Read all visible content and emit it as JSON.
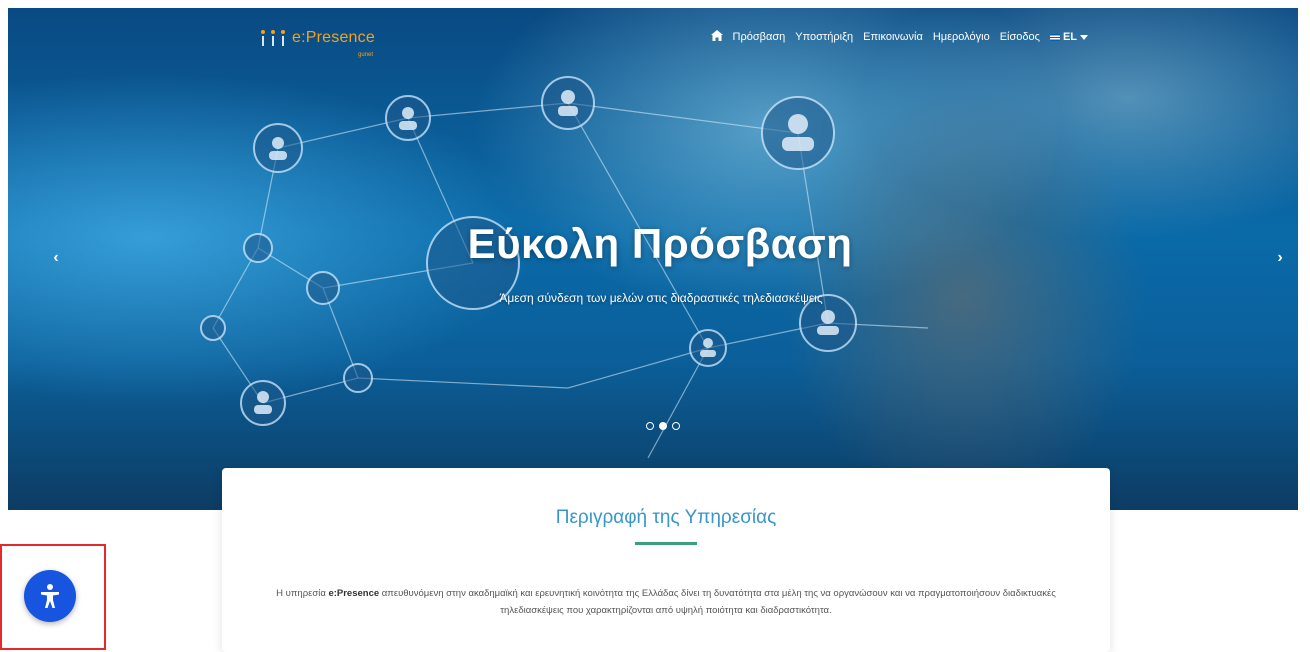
{
  "header": {
    "logo_text": "e:Presence",
    "logo_sub": "gunet",
    "nav": {
      "items": [
        "Πρόσβαση",
        "Υποστήριξη",
        "Επικοινωνία",
        "Ημερολόγιο",
        "Είσοδος"
      ],
      "language": "EL"
    }
  },
  "hero": {
    "title": "Εύκολη Πρόσβαση",
    "subtitle": "Άμεση σύνδεση των μελών στις διαδραστικές τηλεδιασκέψεις",
    "prev_arrow": "‹",
    "next_arrow": "›",
    "slides": 3,
    "active_slide": 2
  },
  "card": {
    "title": "Περιγραφή της Υπηρεσίας",
    "text_before": "Η υπηρεσία ",
    "text_bold": "e:Presence",
    "text_after": " απευθυνόμενη στην ακαδημαϊκή και ερευνητική κοινότητα της Ελλάδας δίνει τη δυνατότητα στα μέλη της να οργανώσουν και να πραγματοποιήσουν διαδικτυακές τηλεδιασκέψεις που χαρακτηρίζονται από υψηλή ποιότητα και διαδραστικότητα."
  },
  "colors": {
    "accent_blue": "#3897c8",
    "rule_green": "#3c9f7e",
    "logo_orange": "#f6a11a",
    "a11y_button": "#1755e0",
    "highlight_frame": "#e32b2b"
  },
  "icons": {
    "home": "home-icon",
    "accessibility": "accessibility-icon",
    "flag": "greek-flag-icon",
    "caret": "caret-down-icon"
  }
}
